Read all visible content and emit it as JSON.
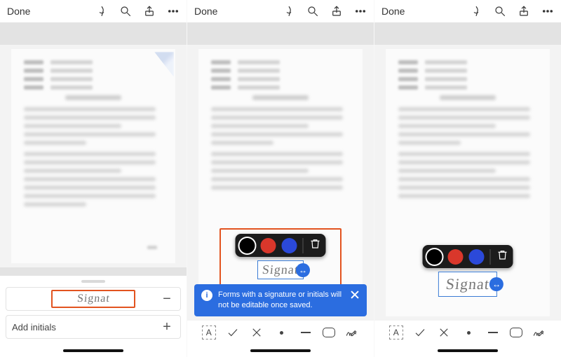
{
  "topbar": {
    "done": "Done",
    "icons": {
      "pen": "pen-icon",
      "search": "search-icon",
      "share": "share-icon",
      "more": "more-icon"
    }
  },
  "tray": {
    "signature_text": "Signat",
    "minus": "−",
    "add_initials": "Add initials",
    "plus": "+"
  },
  "popover": {
    "colors": {
      "black": "#000000",
      "red": "#d9372b",
      "blue": "#2b49d9"
    }
  },
  "placed": {
    "signature_text": "Signat",
    "drag_glyph": "↔"
  },
  "banner": {
    "info_glyph": "i",
    "message": "Forms with a signature or initials will not be editable once saved."
  },
  "toolrow": {
    "textbox": "A"
  }
}
